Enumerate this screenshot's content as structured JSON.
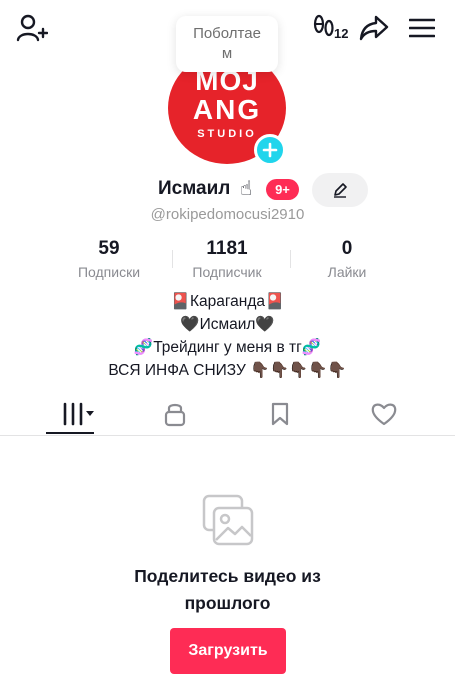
{
  "topbar": {
    "icons": [
      "add-user-icon",
      "footprints-icon",
      "share-icon",
      "menu-icon"
    ],
    "footprint_count": "12"
  },
  "tooltip": {
    "line1": "Поболтае",
    "line2": "м"
  },
  "avatar": {
    "logo_line1": "MOJ",
    "logo_line2": "ANG",
    "logo_line3": "STUDIO",
    "bg_color": "#e6232a",
    "add_icon": "plus-icon",
    "add_color": "#20d5ec"
  },
  "profile": {
    "name": "Исмаил",
    "name_emoji": "☝",
    "badge": "9+",
    "handle": "@rokipedomocusi2910"
  },
  "stats": {
    "following": {
      "value": "59",
      "label": "Подписки"
    },
    "followers": {
      "value": "1181",
      "label": "Подписчик"
    },
    "likes": {
      "value": "0",
      "label": "Лайки"
    }
  },
  "bio": [
    "🎴Караганда🎴",
    "🖤Исмаил🖤",
    "🧬Трейдинг у меня в тг🧬",
    "ВСЯ ИНФА СНИЗУ 👇🏿👇🏿👇🏿👇🏿👇🏿"
  ],
  "tabs": [
    {
      "name": "videos",
      "icon": "grid-icon",
      "active": true
    },
    {
      "name": "private",
      "icon": "lock-icon",
      "active": false
    },
    {
      "name": "saved",
      "icon": "bookmark-icon",
      "active": false
    },
    {
      "name": "liked",
      "icon": "heart-icon",
      "active": false
    }
  ],
  "empty_state": {
    "icon": "photo-gallery-icon",
    "title_line1": "Поделитесь видео из",
    "title_line2": "прошлого",
    "button": "Загрузить"
  },
  "colors": {
    "accent": "#fe2c55",
    "text": "#161823",
    "muted": "#8a8b91"
  }
}
